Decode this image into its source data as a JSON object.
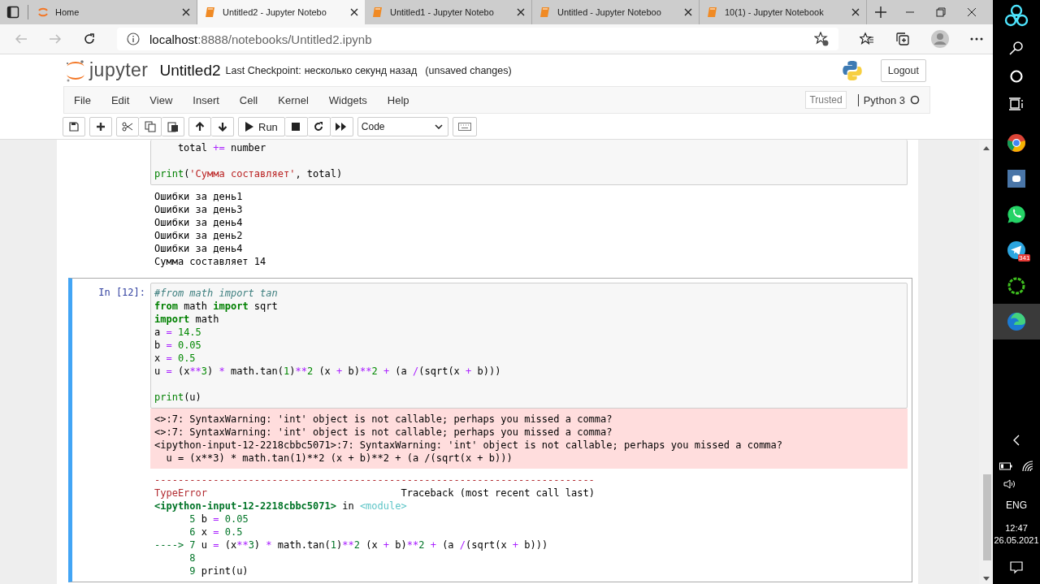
{
  "browser": {
    "tabs": [
      {
        "title": "Home",
        "kind": "home",
        "selected": false
      },
      {
        "title": "Untitled2 - Jupyter Notebo",
        "kind": "notebook",
        "selected": true
      },
      {
        "title": "Untitled1 - Jupyter Notebo",
        "kind": "notebook",
        "selected": false
      },
      {
        "title": "Untitled - Jupyter Noteboo",
        "kind": "notebook",
        "selected": false
      },
      {
        "title": "10(1) - Jupyter Notebook",
        "kind": "notebook",
        "selected": false
      }
    ],
    "address": {
      "host": "localhost",
      "path": ":8888/notebooks/Untitled2.ipynb"
    }
  },
  "header": {
    "logo_text": "jupyter",
    "notebook_name": "Untitled2",
    "checkpoint_label": "Last Checkpoint:",
    "checkpoint_time": "несколько секунд назад",
    "status": "(unsaved changes)",
    "logout": "Logout"
  },
  "menu": [
    "File",
    "Edit",
    "View",
    "Insert",
    "Cell",
    "Kernel",
    "Widgets",
    "Help"
  ],
  "kernel": {
    "trusted": "Trusted",
    "name": "Python 3",
    "busy": false
  },
  "toolbar": {
    "run_label": "Run",
    "cell_type": "Code"
  },
  "cells": [
    {
      "selected": false,
      "code": [
        {
          "tokens": [
            {
              "kind": "plain",
              "text": "    total "
            },
            {
              "kind": "op",
              "text": "+="
            },
            {
              "kind": "plain",
              "text": " number"
            }
          ]
        },
        {
          "gap_before": true,
          "tokens": [
            {
              "kind": "builtin",
              "text": "print"
            },
            {
              "kind": "plain",
              "text": "("
            },
            {
              "kind": "str",
              "text": "'Сумма составляет'"
            },
            {
              "kind": "plain",
              "text": ", total)"
            }
          ]
        }
      ],
      "outputs": [
        {
          "kind": "stream",
          "lines": [
            "Ошибки за день1",
            "Ошибки за день3",
            "Ошибки за день4",
            "Ошибки за день2",
            "Ошибки за день4",
            "Сумма составляет 14"
          ]
        }
      ]
    },
    {
      "selected": true,
      "prompt": "In [12]:",
      "code": [
        {
          "tokens": [
            {
              "kind": "comment",
              "text": "#from math import tan"
            }
          ]
        },
        {
          "tokens": [
            {
              "kind": "kw",
              "text": "from"
            },
            {
              "kind": "plain",
              "text": " math "
            },
            {
              "kind": "kw",
              "text": "import"
            },
            {
              "kind": "plain",
              "text": " sqrt"
            }
          ]
        },
        {
          "tokens": [
            {
              "kind": "kw",
              "text": "import"
            },
            {
              "kind": "plain",
              "text": " math"
            }
          ]
        },
        {
          "tokens": [
            {
              "kind": "plain",
              "text": "a "
            },
            {
              "kind": "op",
              "text": "="
            },
            {
              "kind": "num",
              "text": " 14.5"
            }
          ]
        },
        {
          "tokens": [
            {
              "kind": "plain",
              "text": "b "
            },
            {
              "kind": "op",
              "text": "="
            },
            {
              "kind": "num",
              "text": " 0.05"
            }
          ]
        },
        {
          "tokens": [
            {
              "kind": "plain",
              "text": "x "
            },
            {
              "kind": "op",
              "text": "="
            },
            {
              "kind": "num",
              "text": " 0.5"
            }
          ]
        },
        {
          "tokens": [
            {
              "kind": "plain",
              "text": "u "
            },
            {
              "kind": "op",
              "text": "="
            },
            {
              "kind": "plain",
              "text": " (x"
            },
            {
              "kind": "op",
              "text": "**"
            },
            {
              "kind": "num",
              "text": "3"
            },
            {
              "kind": "plain",
              "text": ") "
            },
            {
              "kind": "op",
              "text": "*"
            },
            {
              "kind": "plain",
              "text": " math.tan("
            },
            {
              "kind": "num",
              "text": "1"
            },
            {
              "kind": "plain",
              "text": ")"
            },
            {
              "kind": "op",
              "text": "**"
            },
            {
              "kind": "num",
              "text": "2"
            },
            {
              "kind": "plain",
              "text": " (x "
            },
            {
              "kind": "op",
              "text": "+"
            },
            {
              "kind": "plain",
              "text": " b)"
            },
            {
              "kind": "op",
              "text": "**"
            },
            {
              "kind": "num",
              "text": "2"
            },
            {
              "kind": "op",
              "text": " +"
            },
            {
              "kind": "plain",
              "text": " (a "
            },
            {
              "kind": "op",
              "text": "/"
            },
            {
              "kind": "plain",
              "text": "(sqrt(x "
            },
            {
              "kind": "op",
              "text": "+"
            },
            {
              "kind": "plain",
              "text": " b)))"
            }
          ]
        },
        {
          "gap_before": true,
          "tokens": [
            {
              "kind": "builtin",
              "text": "print"
            },
            {
              "kind": "plain",
              "text": "(u)"
            }
          ]
        }
      ],
      "outputs": [
        {
          "kind": "stderr",
          "lines": [
            "<>:7: SyntaxWarning: 'int' object is not callable; perhaps you missed a comma?",
            "<>:7: SyntaxWarning: 'int' object is not callable; perhaps you missed a comma?",
            "<ipython-input-12-2218cbbc5071>:7: SyntaxWarning: 'int' object is not callable; perhaps you missed a comma?",
            "  u = (x**3) * math.tan(1)**2 (x + b)**2 + (a /(sqrt(x + b)))"
          ]
        },
        {
          "kind": "error",
          "lines": [
            {
              "tokens": [
                {
                  "kind": "err",
                  "text": "---------------------------------------------------------------------------"
                }
              ]
            },
            {
              "tokens": [
                {
                  "kind": "err",
                  "text": "TypeError"
                },
                {
                  "kind": "plain",
                  "text": "                                 Traceback (most recent call last)"
                }
              ]
            },
            {
              "tokens": [
                {
                  "kind": "file",
                  "text": "<ipython-input-12-2218cbbc5071>"
                },
                {
                  "kind": "plain",
                  "text": " in "
                },
                {
                  "kind": "module",
                  "text": "<module>"
                }
              ]
            },
            {
              "tokens": [
                {
                  "kind": "lineno",
                  "text": "      5 "
                },
                {
                  "kind": "plain",
                  "text": "b "
                },
                {
                  "kind": "op",
                  "text": "="
                },
                {
                  "kind": "tbnum",
                  "text": " 0.05"
                }
              ]
            },
            {
              "tokens": [
                {
                  "kind": "lineno",
                  "text": "      6 "
                },
                {
                  "kind": "plain",
                  "text": "x "
                },
                {
                  "kind": "op",
                  "text": "="
                },
                {
                  "kind": "tbnum",
                  "text": " 0.5"
                }
              ]
            },
            {
              "tokens": [
                {
                  "kind": "lineno",
                  "text": "----> 7 "
                },
                {
                  "kind": "plain",
                  "text": "u "
                },
                {
                  "kind": "op",
                  "text": "="
                },
                {
                  "kind": "plain",
                  "text": " (x"
                },
                {
                  "kind": "op",
                  "text": "**"
                },
                {
                  "kind": "tbnum",
                  "text": "3"
                },
                {
                  "kind": "plain",
                  "text": ") "
                },
                {
                  "kind": "op",
                  "text": "*"
                },
                {
                  "kind": "plain",
                  "text": " math.tan("
                },
                {
                  "kind": "tbnum",
                  "text": "1"
                },
                {
                  "kind": "plain",
                  "text": ")"
                },
                {
                  "kind": "op",
                  "text": "**"
                },
                {
                  "kind": "tbnum",
                  "text": "2"
                },
                {
                  "kind": "plain",
                  "text": " (x "
                },
                {
                  "kind": "op",
                  "text": "+"
                },
                {
                  "kind": "plain",
                  "text": " b)"
                },
                {
                  "kind": "op",
                  "text": "**"
                },
                {
                  "kind": "tbnum",
                  "text": "2"
                },
                {
                  "kind": "op",
                  "text": " +"
                },
                {
                  "kind": "plain",
                  "text": " (a "
                },
                {
                  "kind": "op",
                  "text": "/"
                },
                {
                  "kind": "plain",
                  "text": "(sqrt(x "
                },
                {
                  "kind": "op",
                  "text": "+"
                },
                {
                  "kind": "plain",
                  "text": " b)))"
                }
              ]
            },
            {
              "tokens": [
                {
                  "kind": "lineno",
                  "text": "      8"
                }
              ]
            },
            {
              "tokens": [
                {
                  "kind": "lineno",
                  "text": "      9 "
                },
                {
                  "kind": "plain",
                  "text": "print(u)"
                }
              ]
            }
          ]
        }
      ]
    }
  ],
  "taskbar": {
    "apps": [
      {
        "kind": "chrome",
        "selected": false
      },
      {
        "kind": "vk",
        "selected": false
      },
      {
        "kind": "whatsapp",
        "selected": false
      },
      {
        "kind": "telegram",
        "selected": false,
        "badge": "341"
      },
      {
        "kind": "ring",
        "selected": false
      },
      {
        "kind": "edge",
        "selected": true
      }
    ],
    "language": "ENG",
    "time": "12:47",
    "date": "26.05.2021"
  }
}
